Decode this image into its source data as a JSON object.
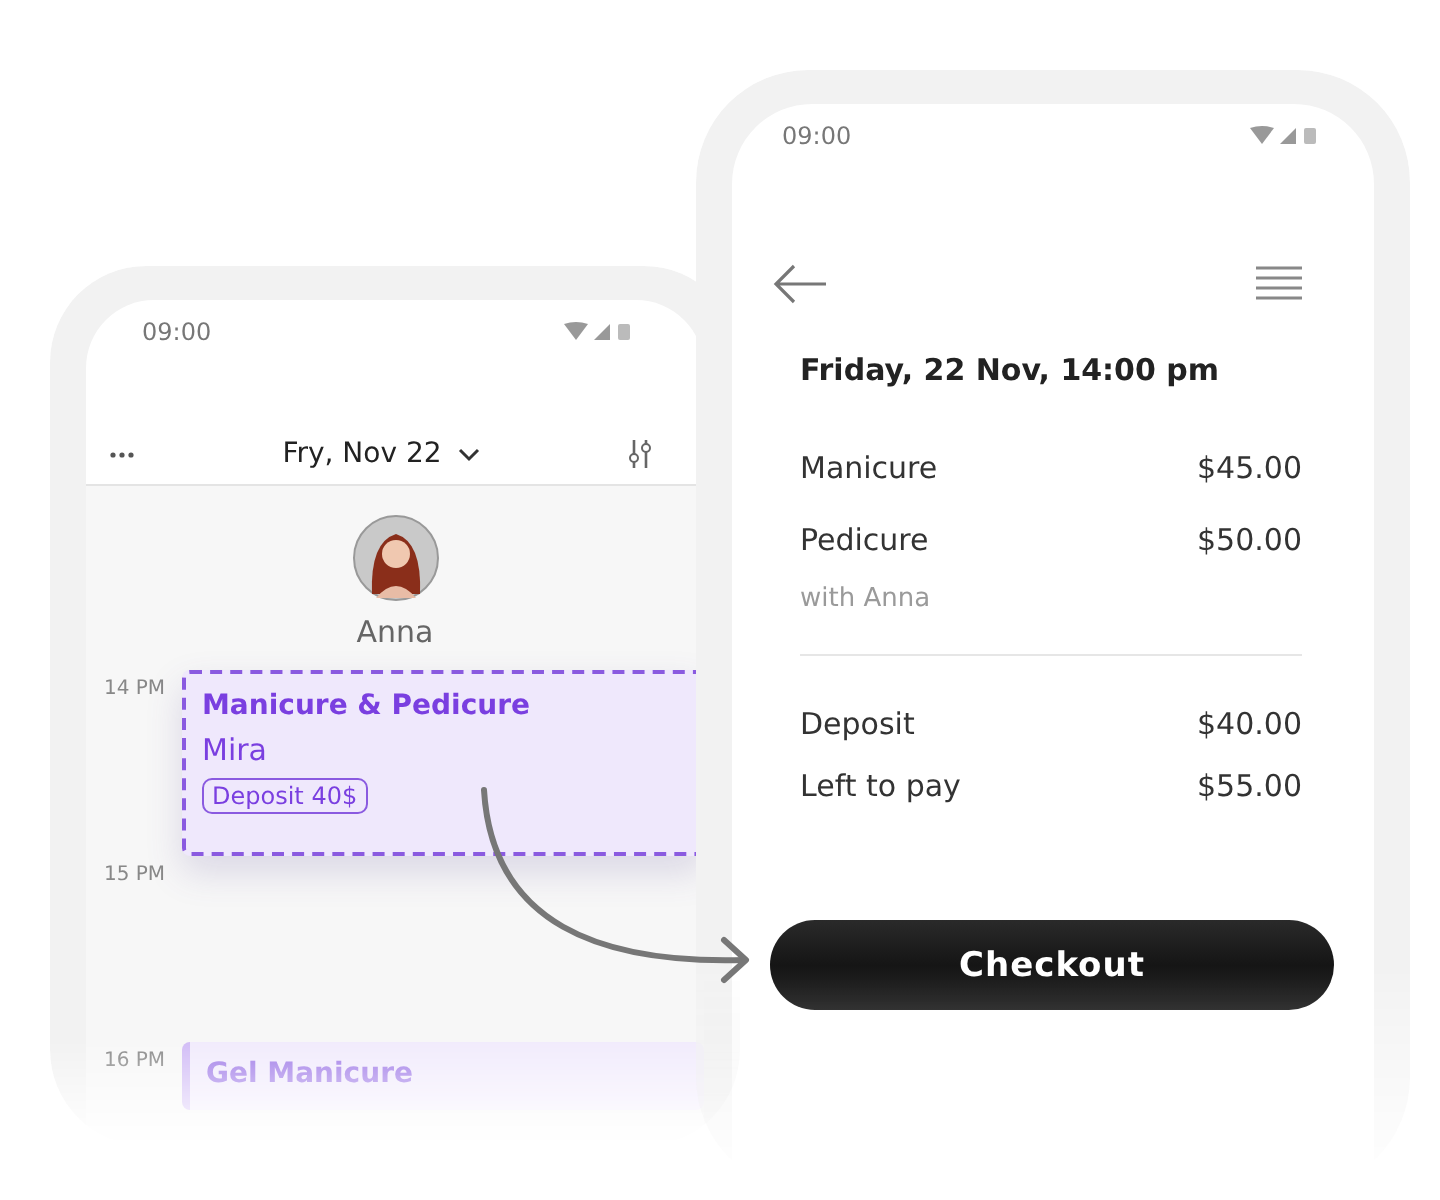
{
  "left_phone": {
    "status_time": "09:00",
    "header": {
      "date": "Fry, Nov 22"
    },
    "staff": {
      "name": "Anna"
    },
    "timeline": [
      {
        "time": "14 PM",
        "appointment": {
          "title": "Manicure & Pedicure",
          "client": "Mira",
          "badge": "Deposit 40$",
          "selected": true
        }
      },
      {
        "time": "15 PM"
      },
      {
        "time": "16 PM",
        "appointment": {
          "title": "Gel Manicure",
          "selected": false
        }
      }
    ]
  },
  "right_phone": {
    "status_time": "09:00",
    "title": "Friday, 22 Nov, 14:00 pm",
    "services": [
      {
        "name": "Manicure",
        "price": "$45.00"
      },
      {
        "name": "Pedicure",
        "price": "$50.00"
      }
    ],
    "staff_note": "with Anna",
    "totals": [
      {
        "label": "Deposit",
        "amount": "$40.00"
      },
      {
        "label": "Left to pay",
        "amount": "$55.00"
      }
    ],
    "button": "Checkout"
  }
}
